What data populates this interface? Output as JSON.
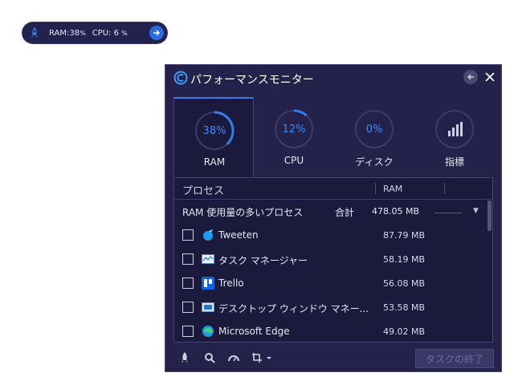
{
  "mini": {
    "ram_label": "RAM:38",
    "ram_unit": "%",
    "cpu_label": "CPU: 6",
    "cpu_unit": "%",
    "icons": [
      "rocket-icon",
      "arrow-right-icon"
    ]
  },
  "window": {
    "title": "パフォーマンスモニター",
    "colors": {
      "background": "#24224a",
      "panel": "#1b1a3d",
      "accent": "#2f80ed"
    }
  },
  "tabs": [
    {
      "value": "38%",
      "label": "RAM",
      "ring_fraction": 0.38,
      "active": true
    },
    {
      "value": "12%",
      "label": "CPU",
      "ring_fraction": 0.12,
      "active": false
    },
    {
      "value": "0%",
      "label": "ディスク",
      "ring_fraction": 0.0,
      "active": false
    },
    {
      "value": "",
      "label": "指標",
      "icon": "bar-chart-icon",
      "active": false
    }
  ],
  "table": {
    "col_process": "プロセス",
    "col_ram": "RAM",
    "group_title": "RAM 使用量の多いプロセス",
    "group_total_label": "合計",
    "group_total_value": "478.05 MB",
    "rows": [
      {
        "name": "Tweeten",
        "ram": "87.79 MB",
        "icon": "tweeten-icon"
      },
      {
        "name": "タスク マネージャー",
        "ram": "58.19 MB",
        "icon": "task-manager-icon"
      },
      {
        "name": "Trello",
        "ram": "56.08 MB",
        "icon": "trello-icon"
      },
      {
        "name": "デスクトップ ウィンドウ マネー...",
        "ram": "53.58 MB",
        "icon": "dwm-icon"
      },
      {
        "name": "Microsoft Edge",
        "ram": "49.02 MB",
        "icon": "edge-icon"
      }
    ]
  },
  "footer": {
    "end_task": "タスクの終了",
    "icons": [
      "rocket-icon",
      "search-icon",
      "speedometer-icon",
      "crop-icon"
    ]
  }
}
